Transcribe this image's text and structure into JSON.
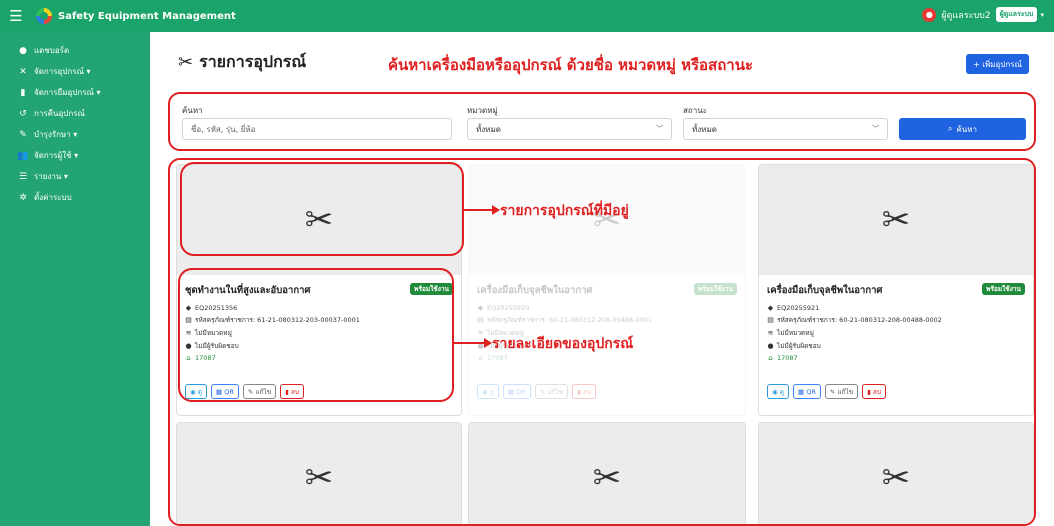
{
  "topbar": {
    "brand": "Safety Equipment Management",
    "user_name": "ผู้ดูแลระบบ2",
    "user_role": "ผู้ดูแลระบบ"
  },
  "sidebar": {
    "items": [
      {
        "icon": "●",
        "label": "แดชบอร์ด"
      },
      {
        "icon": "✕",
        "label": "จัดการอุปกรณ์ ▾"
      },
      {
        "icon": "▮",
        "label": "จัดการยืมอุปกรณ์ ▾"
      },
      {
        "icon": "↺",
        "label": "การคืนอุปกรณ์"
      },
      {
        "icon": "✎",
        "label": "บำรุงรักษา ▾"
      },
      {
        "icon": "👥",
        "label": "จัดการผู้ใช้ ▾"
      },
      {
        "icon": "☰",
        "label": "รายงาน ▾"
      },
      {
        "icon": "✲",
        "label": "ตั้งค่าระบบ"
      }
    ]
  },
  "page": {
    "title": "รายการอุปกรณ์",
    "add_button": "+ เพิ่มอุปกรณ์"
  },
  "annotations": {
    "search": "ค้นหาเครื่องมือหรืออุปกรณ์ ด้วยชื่อ หมวดหมู่ หรือสถานะ",
    "list": "รายการอุปกรณ์ที่มีอยู่",
    "detail": "รายละเอียดของอุปกรณ์"
  },
  "filters": {
    "search_label": "ค้นหา",
    "search_placeholder": "ชื่อ, รหัส, รุ่น, ยี่ห้อ",
    "category_label": "หมวดหมู่",
    "category_value": "ทั้งหมด",
    "status_label": "สถานะ",
    "status_value": "ทั้งหมด",
    "search_button": "ค้นหา"
  },
  "cards": [
    {
      "name": "ชุดทำงานในที่สูงและอับอากาศ",
      "badge": "พร้อมใช้งาน",
      "code": "EQ20251356",
      "asset": "รหัสครุภัณฑ์ราชการ: 61-21-080312-203-00037-0001",
      "category": "ไม่มีหมวดหมู่",
      "owner": "ไม่มีผู้รับผิดชอบ",
      "location": "17087"
    },
    {
      "name": "เครื่องมือเก็บจุลชีพในอากาศ",
      "badge": "พร้อมใช้งาน",
      "code": "EQ20255920",
      "asset": "รหัสครุภัณฑ์ราชการ: 60-21-080312-208-00488-0001",
      "category": "ไม่มีหมวดหมู่",
      "owner": "ไม่มีผู้รับผิดชอบ",
      "location": "17087"
    },
    {
      "name": "เครื่องมือเก็บจุลชีพในอากาศ",
      "badge": "พร้อมใช้งาน",
      "code": "EQ20255921",
      "asset": "รหัสครุภัณฑ์ราชการ: 60-21-080312-208-00488-0002",
      "category": "ไม่มีหมวดหมู่",
      "owner": "ไม่มีผู้รับผิดชอบ",
      "location": "17087"
    }
  ],
  "card_buttons": {
    "view": "ดู",
    "qr": "QR",
    "edit": "แก้ไข",
    "delete": "ลบ"
  }
}
